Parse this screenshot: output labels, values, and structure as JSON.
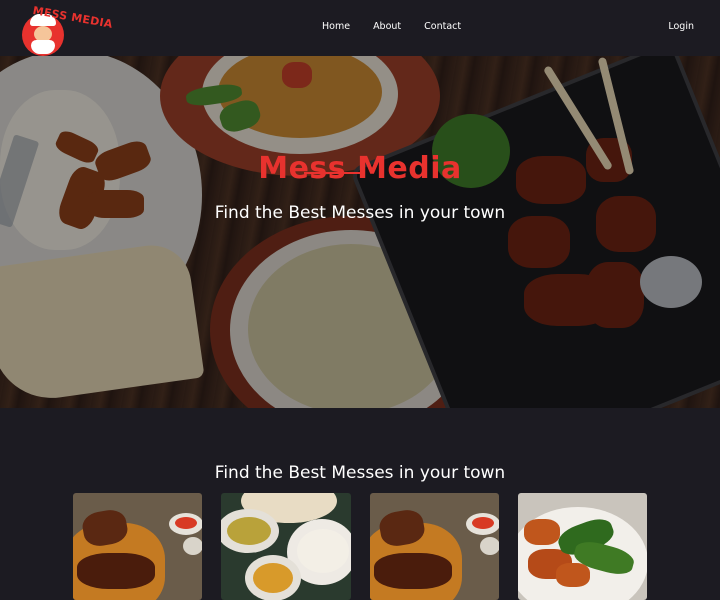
{
  "nav": {
    "logo_text": "MESS MEDIA",
    "items": [
      "Home",
      "About",
      "Contact"
    ],
    "login": "Login"
  },
  "hero": {
    "title": "Mess Media",
    "subtitle": "Find the Best Messes in your town"
  },
  "section": {
    "title": "Find the Best Messes in your town",
    "cards": [
      {
        "name": "biryani-photo"
      },
      {
        "name": "thali-photo"
      },
      {
        "name": "biryani-photo"
      },
      {
        "name": "chicken-salad-photo"
      }
    ]
  },
  "colors": {
    "background": "#1c1b22",
    "accent": "#e8322e",
    "text": "#ffffff"
  }
}
